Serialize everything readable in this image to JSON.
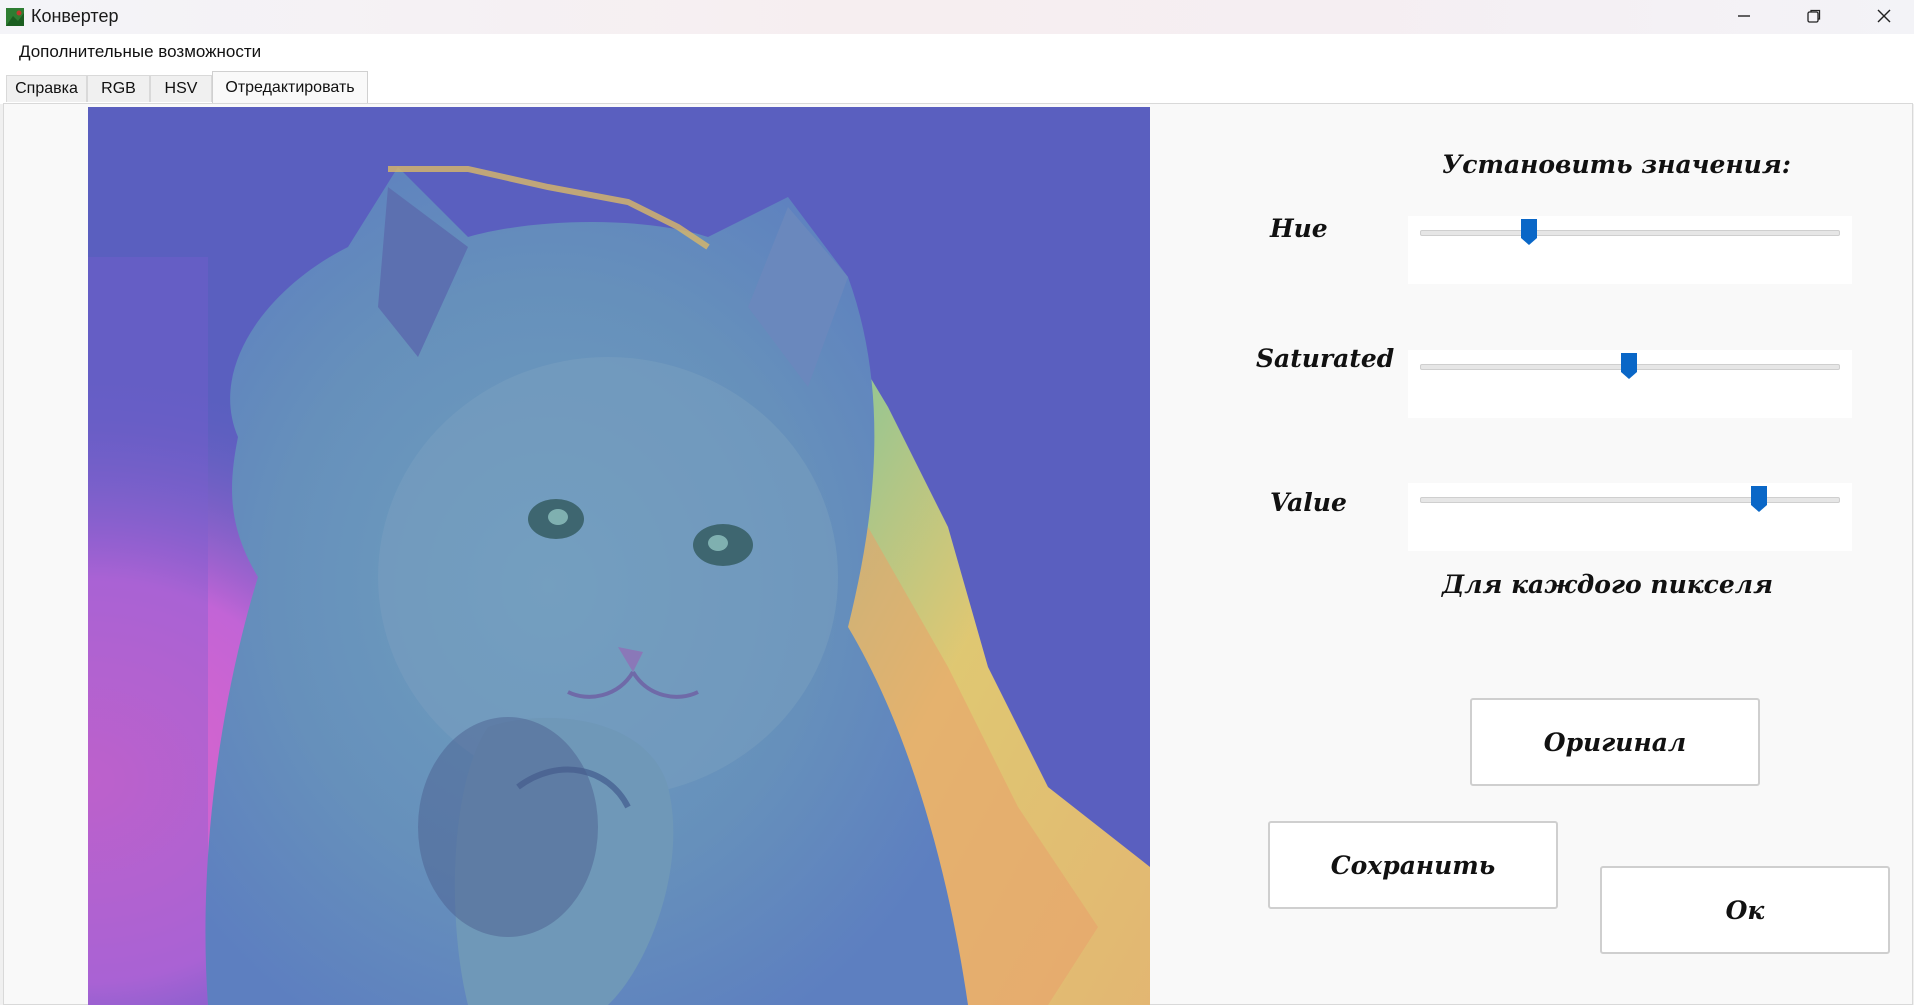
{
  "window": {
    "title": "Конвертер"
  },
  "menu": {
    "extra_label": "Дополнительные возможности"
  },
  "tabs": [
    {
      "label": "Справка"
    },
    {
      "label": "RGB"
    },
    {
      "label": "HSV"
    },
    {
      "label": "Отредактировать",
      "selected": true
    }
  ],
  "controls": {
    "title": "Установить значения:",
    "sliders": [
      {
        "label": "Hue",
        "value_fraction": 0.26
      },
      {
        "label": "Saturated",
        "value_fraction": 0.5
      },
      {
        "label": "Value",
        "value_fraction": 0.81
      }
    ],
    "per_pixel_label": "Для каждого пикселя",
    "buttons": {
      "original": "Оригинал",
      "save": "Сохранить",
      "ok": "Ок"
    }
  },
  "colors": {
    "slider_thumb": "#0a67c7",
    "image_background": "#5a60bf",
    "image_highlight": "#e8d46a",
    "image_magenta": "#d15fc8"
  },
  "icons": {
    "app": "image-app-icon",
    "minimize": "minimize-icon",
    "maximize": "restore-icon",
    "close": "close-icon"
  }
}
